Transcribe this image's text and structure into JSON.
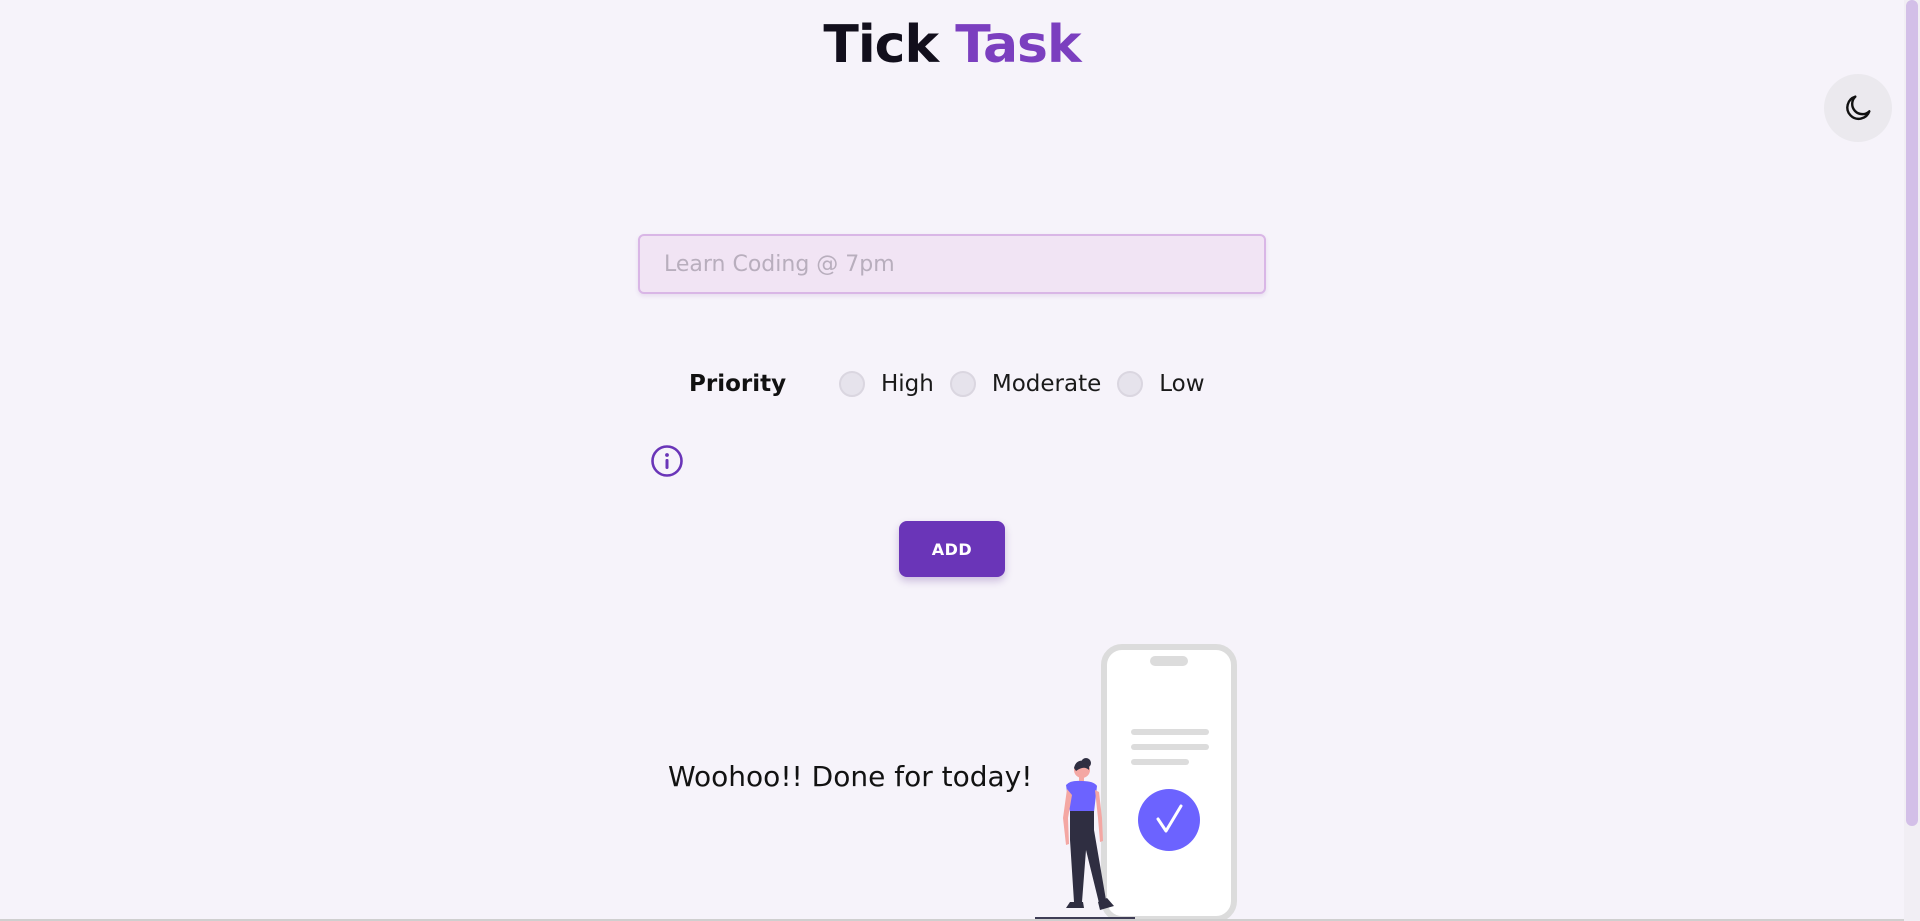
{
  "header": {
    "title_part1": "Tick",
    "title_part2": "Task"
  },
  "theme_toggle": {
    "icon": "moon-icon"
  },
  "task_form": {
    "input_value": "",
    "input_placeholder": "Learn Coding @ 7pm",
    "priority_label": "Priority",
    "priority_options": [
      {
        "label": "High",
        "selected": false
      },
      {
        "label": "Moderate",
        "selected": false
      },
      {
        "label": "Low",
        "selected": false
      }
    ],
    "info_icon": "info-icon",
    "add_label": "ADD"
  },
  "empty_state": {
    "message": "Woohoo!! Done for today!",
    "illustration": "person-with-phone-checkmark-illustration"
  },
  "colors": {
    "accent": "#6a35b8",
    "title_accent": "#7b3fbf",
    "background": "#f6f3fa",
    "check_circle": "#6c63ff"
  }
}
